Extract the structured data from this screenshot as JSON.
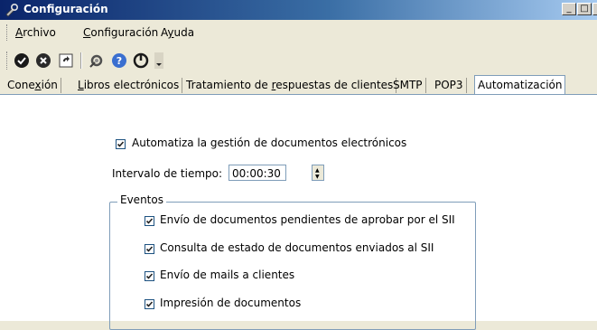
{
  "window": {
    "title": "Configuración",
    "min_glyph": "_",
    "max_glyph": "□"
  },
  "menu": [
    {
      "label": "Archivo",
      "u": "A",
      "rest": "rchivo"
    },
    {
      "label": "Configuración",
      "u": "C",
      "rest": "onfiguración"
    },
    {
      "label": "Ayuda",
      "pre": "A",
      "u": "y",
      "rest": "uda"
    }
  ],
  "toolbar": {
    "icons": [
      "ok-icon",
      "cancel-icon",
      "refresh-icon",
      "tools-icon",
      "help-icon",
      "power-icon",
      "overflow-icon"
    ]
  },
  "tabs": [
    {
      "label": "Conexión",
      "pre": "Cone",
      "u": "x",
      "rest": "ión"
    },
    {
      "label": "Libros electrónicos",
      "pre": "",
      "u": "L",
      "rest": "ibros electrónicos"
    },
    {
      "label": "Tratamiento de respuestas de clientes",
      "pre": "Tratamiento de ",
      "u": "r",
      "rest": "espuestas de clientes"
    },
    {
      "label": "SMTP",
      "pre": "SMTP",
      "u": "",
      "rest": ""
    },
    {
      "label": "POP3",
      "pre": "POP3",
      "u": "",
      "rest": ""
    },
    {
      "label": "Automatización",
      "pre": "Automatización",
      "u": "",
      "rest": "",
      "active": true
    }
  ],
  "automation": {
    "enable_label": "Automatiza la gestión de documentos electrónicos",
    "enable_checked": true,
    "interval_label": "Intervalo de tiempo:",
    "interval_value": "00:00:30"
  },
  "events": {
    "title": "Eventos",
    "items": [
      {
        "label": "Envío de documentos pendientes de aprobar por el SII",
        "checked": true
      },
      {
        "label": "Consulta de estado de documentos enviados al SII",
        "checked": true
      },
      {
        "label": "Envío de mails a clientes",
        "checked": true
      },
      {
        "label": "Impresión de documentos",
        "checked": true
      }
    ]
  }
}
